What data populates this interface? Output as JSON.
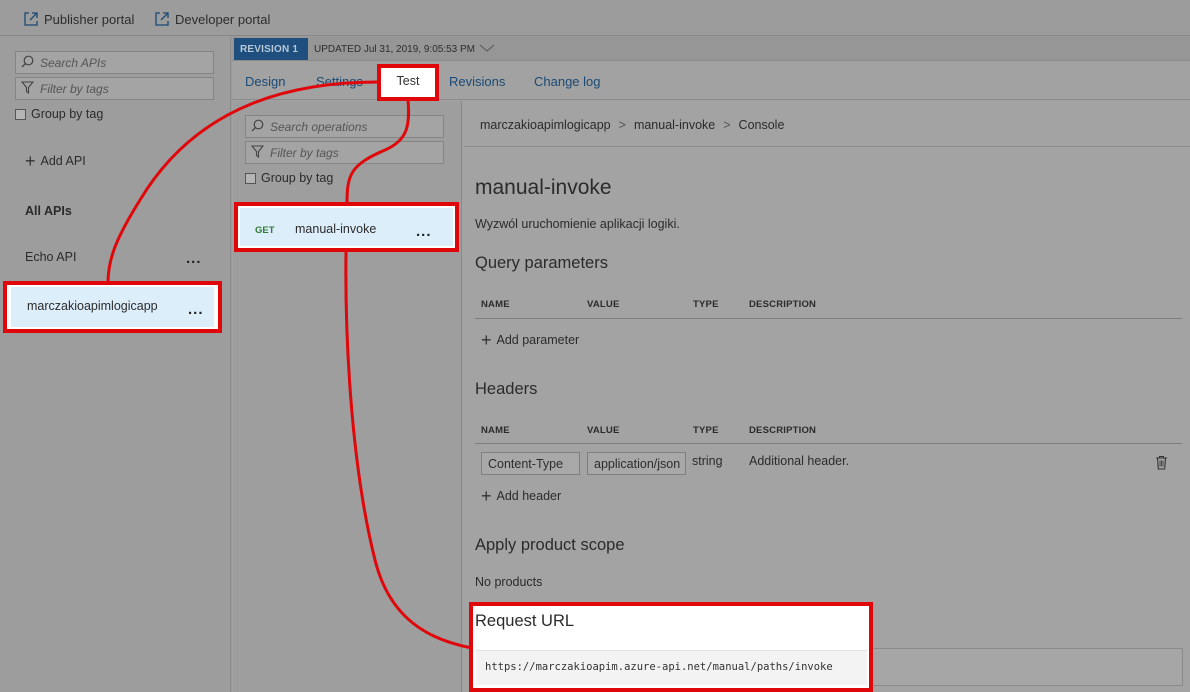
{
  "topbar": {
    "publisher_portal": "Publisher portal",
    "developer_portal": "Developer portal"
  },
  "left": {
    "search_placeholder": "Search APIs",
    "filter_placeholder": "Filter by tags",
    "group_by_tag": "Group by tag",
    "add_api": "Add API",
    "all_apis": "All APIs",
    "apis": [
      {
        "name": "Echo API"
      },
      {
        "name": "marczakioapimlogicapp"
      }
    ],
    "more": "..."
  },
  "revision": {
    "badge": "REVISION 1",
    "updated": "UPDATED Jul 31, 2019, 9:05:53 PM"
  },
  "tabs": {
    "design": "Design",
    "settings": "Settings",
    "test": "Test",
    "revisions": "Revisions",
    "changelog": "Change log"
  },
  "ops": {
    "search_placeholder": "Search operations",
    "filter_placeholder": "Filter by tags",
    "group_by_tag": "Group by tag",
    "items": [
      {
        "method": "GET",
        "name": "manual-invoke"
      }
    ],
    "more": "..."
  },
  "breadcrumb": {
    "api": "marczakioapimlogicapp",
    "op": "manual-invoke",
    "page": "Console",
    "sep": ">"
  },
  "detail": {
    "title": "manual-invoke",
    "description": "Wyzwól uruchomienie aplikacji logiki.",
    "query_title": "Query parameters",
    "cols": {
      "name": "NAME",
      "value": "VALUE",
      "type": "TYPE",
      "description": "DESCRIPTION"
    },
    "add_parameter": "Add parameter",
    "headers_title": "Headers",
    "header_row": {
      "name": "Content-Type",
      "value": "application/json",
      "type": "string",
      "description": "Additional header."
    },
    "add_header": "Add header",
    "product_scope_title": "Apply product scope",
    "no_products": "No products",
    "request_url_title": "Request URL",
    "request_url": "https://marczakioapim.azure-api.net/manual/paths/invoke"
  },
  "colors": {
    "highlight": "#e0070b",
    "link": "#1a4a75",
    "badge": "#1e4f7e",
    "get": "#2e7d32"
  }
}
